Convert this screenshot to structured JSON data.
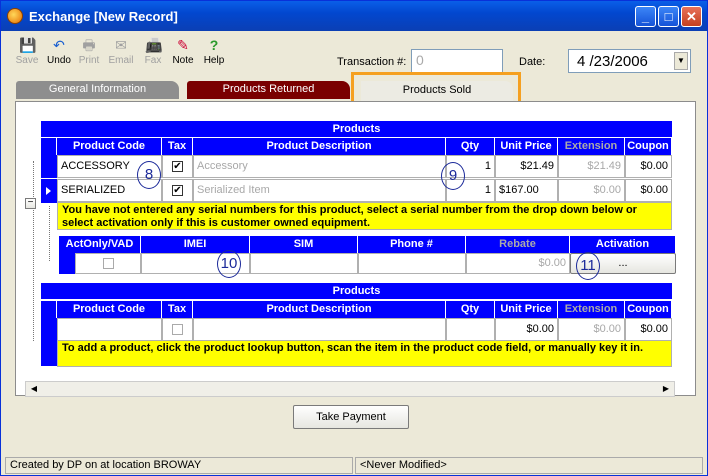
{
  "window": {
    "title": "Exchange [New Record]"
  },
  "titlebar_buttons": {
    "minimize": "_",
    "maximize": "□",
    "close": "✕"
  },
  "toolbar": [
    {
      "label": "Save",
      "icon": "save-icon",
      "enabled": false
    },
    {
      "label": "Undo",
      "icon": "undo-icon",
      "enabled": true
    },
    {
      "label": "Print",
      "icon": "print-icon",
      "enabled": false
    },
    {
      "label": "Email",
      "icon": "email-icon",
      "enabled": false
    },
    {
      "label": "Fax",
      "icon": "fax-icon",
      "enabled": false
    },
    {
      "label": "Note",
      "icon": "note-icon",
      "enabled": true
    },
    {
      "label": "Help",
      "icon": "help-icon",
      "enabled": true
    }
  ],
  "transaction": {
    "label": "Transaction #:",
    "value": "0"
  },
  "date": {
    "label": "Date:",
    "value": "4 /23/2006"
  },
  "tabs": [
    {
      "label": "General Information"
    },
    {
      "label": "Products Returned"
    },
    {
      "label": "Products Sold"
    }
  ],
  "products_top": {
    "title": "Products",
    "columns": [
      "Product Code",
      "Tax",
      "Product Description",
      "Qty",
      "Unit Price",
      "Extension",
      "Coupon"
    ],
    "rows": [
      {
        "code": "ACCESSORY",
        "tax": true,
        "description": "Accessory",
        "qty": "1",
        "unit_price": "$21.49",
        "extension": "$21.49",
        "coupon": "$0.00"
      },
      {
        "code": "SERIALIZED",
        "tax": true,
        "description": "Serialized Item",
        "qty": "1",
        "unit_price": "$167.00",
        "extension": "$0.00",
        "coupon": "$0.00"
      }
    ],
    "message": "You have not entered any serial numbers for this product, select a serial number from the drop down below or select activation only if this is customer owned equipment."
  },
  "serial": {
    "columns": [
      "ActOnly/VAD",
      "IMEI",
      "SIM",
      "Phone #",
      "Rebate",
      "Activation"
    ],
    "row": {
      "rebate": "$0.00",
      "activation": "..."
    }
  },
  "products_bottom": {
    "title": "Products",
    "columns": [
      "Product Code",
      "Tax",
      "Product Description",
      "Qty",
      "Unit Price",
      "Extension",
      "Coupon"
    ],
    "row": {
      "unit_price": "$0.00",
      "extension": "$0.00",
      "coupon": "$0.00"
    },
    "message": "To add a product, click the product lookup button, scan the item in the product code field, or manually key it in."
  },
  "callouts": [
    "8",
    "9",
    "10",
    "11"
  ],
  "take_payment": "Take Payment",
  "tree_toggle": "−",
  "scroll": {
    "left": "◀",
    "right": "▶"
  },
  "status": {
    "left": "Created by DP on  at location BROWAY",
    "right": "<Never Modified>"
  },
  "colors": {
    "header_blue": "#0000ff",
    "message_yellow": "#ffff00",
    "tab_returned": "#7a0000",
    "highlight": "#f5a020"
  }
}
